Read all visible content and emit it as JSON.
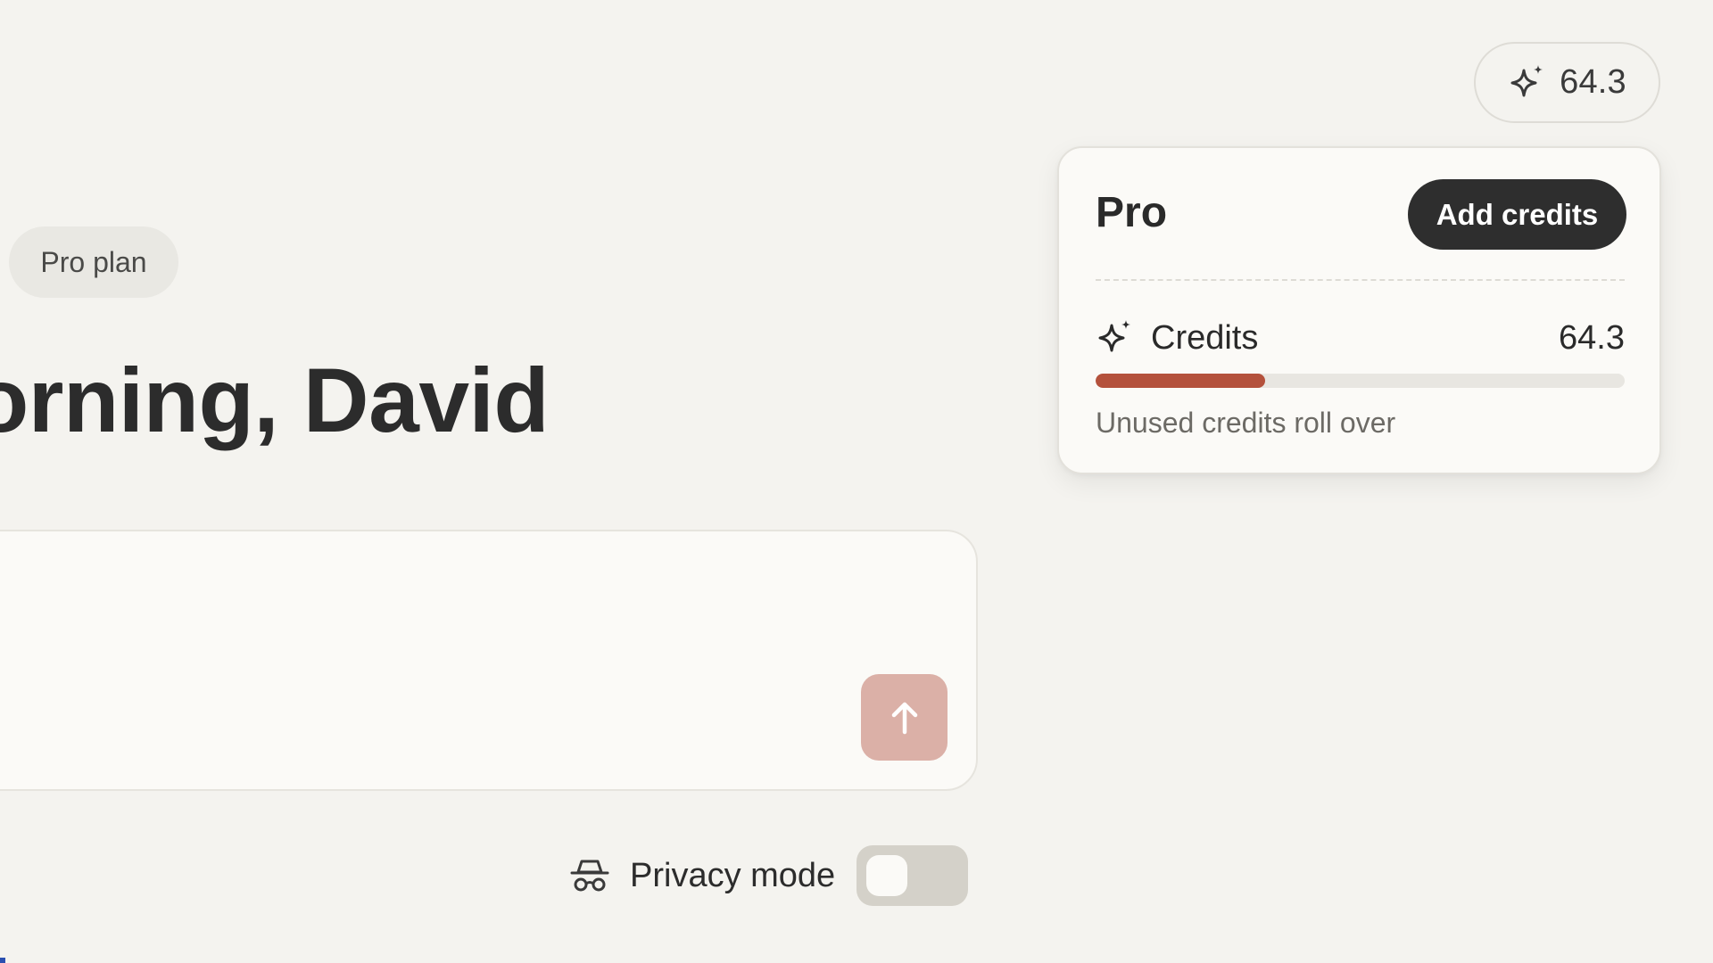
{
  "header": {
    "credits_pill": {
      "icon": "sparkle-icon",
      "value": "64.3"
    }
  },
  "plan_card": {
    "title": "Pro",
    "add_credits_label": "Add credits",
    "credits": {
      "icon": "sparkle-icon",
      "label": "Credits",
      "value": "64.3",
      "usage_fraction": 0.32,
      "bar_color": "#b4513c"
    },
    "note": "Unused credits roll over"
  },
  "main": {
    "plan_badge": "Pro plan",
    "greeting": "orning, David",
    "prompt": {
      "value": "",
      "send_icon": "arrow-up-icon",
      "send_color": "#dbb0a7"
    },
    "privacy": {
      "icon": "incognito-icon",
      "label": "Privacy mode",
      "enabled": false
    }
  },
  "colors": {
    "background": "#f4f3ef",
    "card": "#fbfaf7",
    "dark_button": "#2e2e2e",
    "accent": "#b4513c"
  }
}
